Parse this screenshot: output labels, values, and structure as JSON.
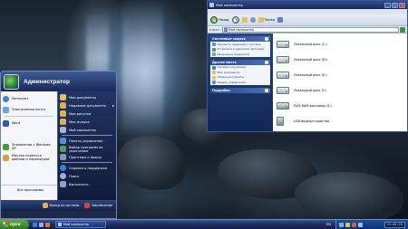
{
  "colors": {
    "accent": "#2a4a8c",
    "start_green": "#3f8a1f",
    "taskbar": "#1e3366"
  },
  "start_menu": {
    "user": "Администратор",
    "left_items": [
      {
        "label": "Интернет",
        "icon": "globe-icon",
        "color": "#3c7de0"
      },
      {
        "label": "Электронная почта",
        "icon": "mail-icon",
        "color": "#6da0e6"
      },
      {
        "label": "Word",
        "icon": "word-icon",
        "color": "#2a5fb0"
      },
      {
        "label": "Знакомство с Windows XP",
        "icon": "xp-tour-icon",
        "color": "#4d9a3a"
      },
      {
        "label": "Мастер переноса файлов и параметров",
        "icon": "transfer-wizard-icon",
        "color": "#d8a23a"
      }
    ],
    "all_programs": "Все программы",
    "right_items": [
      {
        "label": "Мои документы",
        "icon": "documents-icon",
        "color": "#e4c25a",
        "arrow": ""
      },
      {
        "label": "Недавние документы",
        "icon": "recent-docs-icon",
        "color": "#d6b04c",
        "arrow": "▸"
      },
      {
        "label": "Мои рисунки",
        "icon": "pictures-icon",
        "color": "#d9b24e",
        "arrow": ""
      },
      {
        "label": "Моя музыка",
        "icon": "music-icon",
        "color": "#d9b24e",
        "arrow": ""
      },
      {
        "label": "Мой компьютер",
        "icon": "computer-icon",
        "color": "#a9b5c8",
        "arrow": ""
      },
      {
        "label": "Панель управления",
        "icon": "control-panel-icon",
        "color": "#5b8fd6",
        "arrow": ""
      },
      {
        "label": "Выбор программ по умолчанию",
        "icon": "default-programs-icon",
        "color": "#4ca64a",
        "arrow": ""
      },
      {
        "label": "Принтеры и факсы",
        "icon": "printer-icon",
        "color": "#8c96a8",
        "arrow": ""
      },
      {
        "label": "Справка и поддержка",
        "icon": "help-icon",
        "color": "#3c7de0",
        "arrow": ""
      },
      {
        "label": "Поиск",
        "icon": "search-icon",
        "color": "#9ab0d6",
        "arrow": ""
      },
      {
        "label": "Выполнить...",
        "icon": "run-icon",
        "color": "#8fa3c8",
        "arrow": ""
      }
    ],
    "footer": {
      "logoff": "Выход из системы",
      "shutdown": "Выключение"
    }
  },
  "explorer": {
    "title": "Мой компьютер",
    "toolbar": {
      "back": "Назад",
      "folders": "Папки"
    },
    "address_label": "Адрес:",
    "address": "Мой компьютер",
    "panels": [
      {
        "title": "Системные задачи",
        "items": [
          {
            "label": "Просмотр сведений о системе",
            "color": "#6b8bc8"
          },
          {
            "label": "Установка и удаление программ",
            "color": "#5aa24a"
          },
          {
            "label": "Изменение параметра",
            "color": "#8e9bb4"
          }
        ]
      },
      {
        "title": "Другие места",
        "items": [
          {
            "label": "Сетевое окружение",
            "color": "#4c7cc4"
          },
          {
            "label": "Мои документы",
            "color": "#e4c25a"
          },
          {
            "label": "Общие документы",
            "color": "#e4c25a"
          },
          {
            "label": "Панель управления",
            "color": "#5b8fd6"
          }
        ]
      },
      {
        "title": "Подробно",
        "items": []
      }
    ],
    "drives": [
      {
        "label": "Локальный диск (C:)",
        "type": "hdd"
      },
      {
        "label": "Локальный диск (D:)",
        "type": "hdd"
      },
      {
        "label": "Локальный диск (E:)",
        "type": "hdd"
      },
      {
        "label": "Локальный диск (F:)",
        "type": "hdd"
      },
      {
        "label": "DVD-RAM дисковод (G:)",
        "type": "cd"
      },
      {
        "label": "USB-видеоустройство",
        "type": "usb"
      }
    ]
  },
  "taskbar": {
    "start": "пуск",
    "task": "Мой компьютер",
    "lang": "EN",
    "clock": "11:45:23"
  }
}
